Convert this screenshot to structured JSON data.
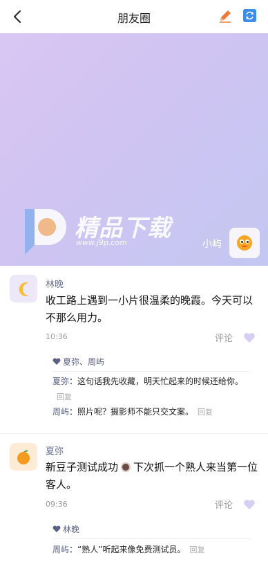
{
  "nav": {
    "title": "朋友圈",
    "back_icon": "chevron-left-icon",
    "edit_icon": "pencil-icon",
    "refresh_icon": "refresh-icon",
    "edit_color": "#f07a3a",
    "refresh_color": "#3c8ee8"
  },
  "cover": {
    "watermark_text": "精品下载",
    "watermark_url": "www.j9p.com",
    "owner_name": "小屿",
    "owner_avatar_icon": "smiley-face-icon"
  },
  "posts": [
    {
      "author": "林晚",
      "avatar_icon": "crescent-moon-icon",
      "content": "收工路上遇到一小片很温柔的晚霞。今天可以不那么用力。",
      "time": "10:36",
      "comment_label": "评论",
      "like_icon": "heart-icon",
      "likes": "夏弥、周屿",
      "comments": [
        {
          "author": "夏弥",
          "text": "这句话我先收藏，明天忙起来的时候还给你。",
          "reply": "回复"
        },
        {
          "author": "周屿",
          "text": "照片呢？摄影师不能只交文案。",
          "reply": "回复"
        }
      ]
    },
    {
      "author": "夏弥",
      "avatar_icon": "orange-fruit-icon",
      "content_before": "新豆子测试成功",
      "content_emoji": "coffee-cup-icon",
      "content_after": "下次抓一个熟人来当第一位客人。",
      "time": "09:36",
      "comment_label": "评论",
      "like_icon": "heart-icon",
      "likes": "林晚",
      "comments": [
        {
          "author": "周屿",
          "text": "“熟人”听起来像免费测试员。",
          "reply": "回复"
        }
      ]
    }
  ]
}
